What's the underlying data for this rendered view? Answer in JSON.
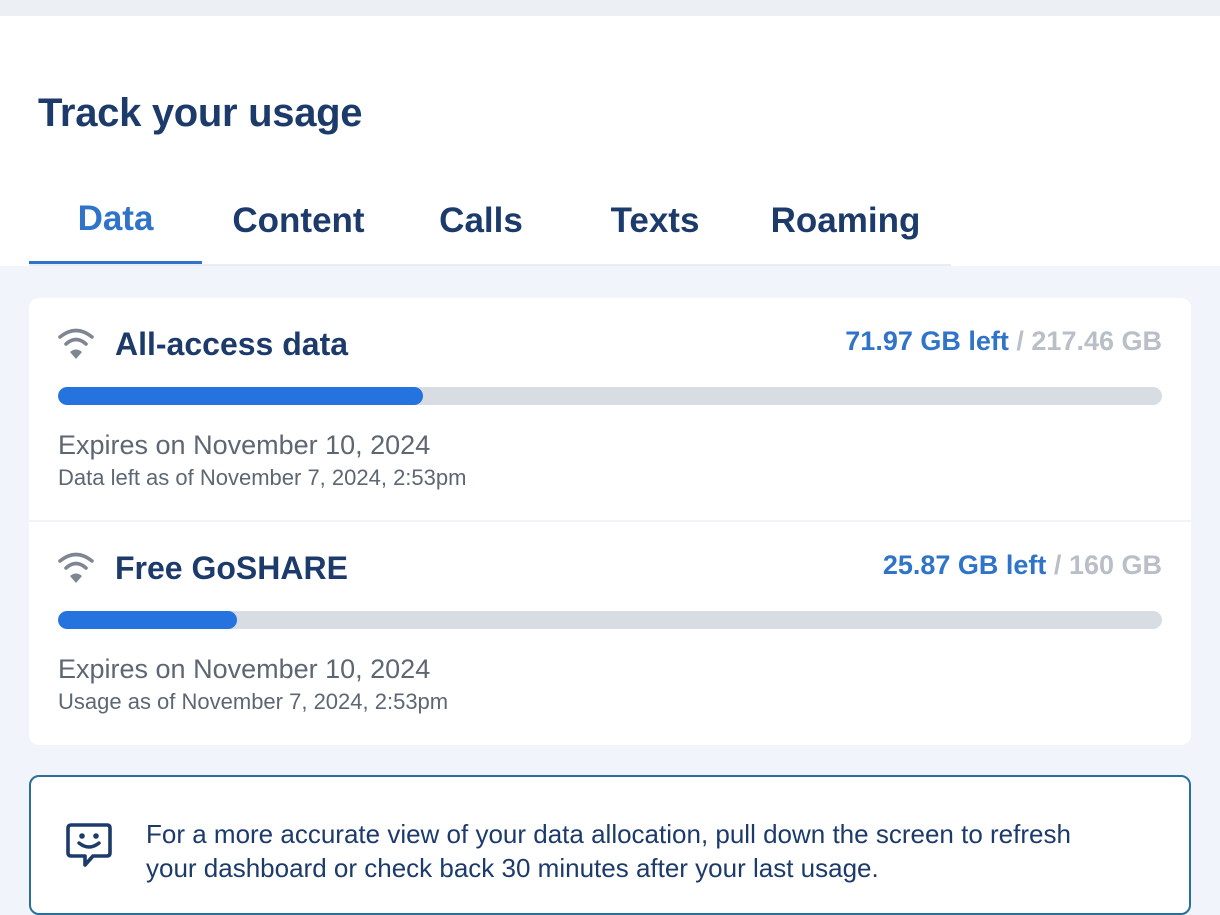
{
  "header": {
    "title": "Track your usage"
  },
  "tabs": [
    {
      "label": "Data",
      "active": true
    },
    {
      "label": "Content",
      "active": false
    },
    {
      "label": "Calls",
      "active": false
    },
    {
      "label": "Texts",
      "active": false
    },
    {
      "label": "Roaming",
      "active": false
    }
  ],
  "usage": [
    {
      "icon": "wifi-icon",
      "name": "All-access data",
      "left": "71.97 GB left",
      "separator": "/",
      "total": "217.46 GB",
      "fraction_left": 0.331,
      "expires": "Expires on November 10, 2024",
      "as_of": "Data left as of November 7, 2024, 2:53pm"
    },
    {
      "icon": "wifi-icon",
      "name": "Free GoSHARE",
      "left": "25.87 GB left",
      "separator": "/",
      "total": "160 GB",
      "fraction_left": 0.162,
      "expires": "Expires on November 10, 2024",
      "as_of": "Usage as of November 7, 2024, 2:53pm"
    }
  ],
  "info": {
    "icon": "chat-smile-icon",
    "text": "For a more accurate view of your data allocation, pull down the screen to refresh your dashboard or check back 30 minutes after your last usage."
  },
  "colors": {
    "primary": "#1c3b6b",
    "accent": "#2f74c9",
    "progress": "#2473de",
    "track": "#d8dde3",
    "muted": "#b9bfc7"
  }
}
